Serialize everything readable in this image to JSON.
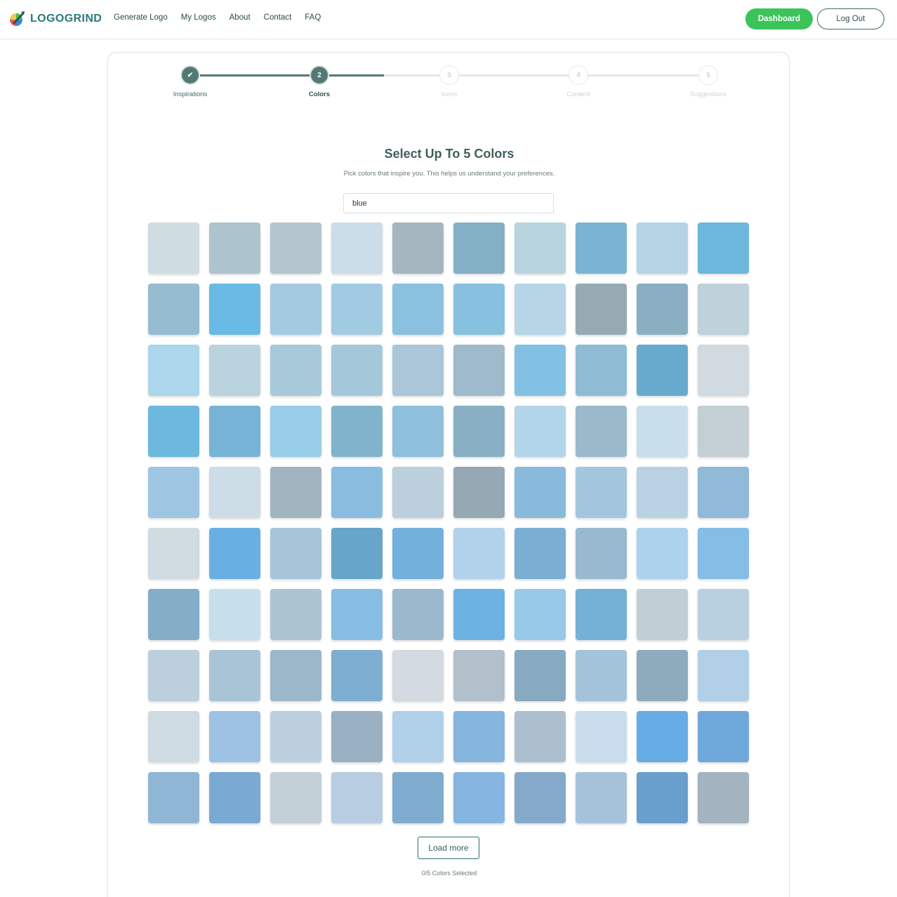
{
  "header": {
    "brand": "LOGOGRIND",
    "nav": [
      "Generate Logo",
      "My Logos",
      "About",
      "Contact",
      "FAQ"
    ],
    "dashboard_label": "Dashboard",
    "logout_label": "Log Out"
  },
  "stepper": {
    "steps": [
      {
        "marker": "✔",
        "label": "Inspirations",
        "state": "done"
      },
      {
        "marker": "2",
        "label": "Colors",
        "state": "active"
      },
      {
        "marker": "3",
        "label": "Icons",
        "state": "todo"
      },
      {
        "marker": "4",
        "label": "Content",
        "state": "todo"
      },
      {
        "marker": "5",
        "label": "Suggestions",
        "state": "todo"
      }
    ]
  },
  "main": {
    "title": "Select Up To 5 Colors",
    "subtitle": "Pick colors that inspire you. This helps us understand your preferences.",
    "search_value": "blue",
    "load_more_label": "Load more",
    "selected_count": "0/5 Colors Selected"
  },
  "colors": {
    "swatches": [
      "#cfdde3",
      "#adc4cf",
      "#b4c4cc",
      "#cadde8",
      "#a5b6c1",
      "#84b0c6",
      "#b8d4df",
      "#7ab4d3",
      "#b4d3e5",
      "#6cb7dc",
      "#95bcd1",
      "#69bae4",
      "#a3cae0",
      "#a1cbe2",
      "#89c1de",
      "#86c1e0",
      "#b6d6e8",
      "#96aab4",
      "#8bafc2",
      "#bfd1da",
      "#abd6eb",
      "#bbd3de",
      "#a8c9da",
      "#a4c8da",
      "#aac6d8",
      "#9fbacb",
      "#82c1e3",
      "#8fbcd4",
      "#67aacd",
      "#d0dae0",
      "#6cb8df",
      "#76b3d6",
      "#98cde9",
      "#81b3cc",
      "#8ebfdb",
      "#88afc3",
      "#b3d5e9",
      "#9ab9cb",
      "#c9deeb",
      "#c3ced5",
      "#9ec6e2",
      "#ccdde8",
      "#a3b4c1",
      "#8abce0",
      "#bbcfdc",
      "#95a8b4",
      "#8abadb",
      "#a3c6df",
      "#b8d2e4",
      "#91b9d8",
      "#d0dbe2",
      "#68b0e2",
      "#a7c4d8",
      "#67a5cb",
      "#72b1dc",
      "#b1d2ea",
      "#7aaed3",
      "#98b9cf",
      "#add2ee",
      "#85bde6",
      "#84adc8",
      "#c6dfeb",
      "#acc4d2",
      "#88bde3",
      "#9bb9cd",
      "#6cb3e3",
      "#98c9e9",
      "#75b1d7",
      "#c0ced5",
      "#b9d0e0",
      "#bbcfdc",
      "#a9c4d6",
      "#9cb7ca",
      "#7eaed0",
      "#d3dae1",
      "#b1c0ca",
      "#87a9c2",
      "#a3c3da",
      "#8eaabd",
      "#b1d0e8",
      "#cfdbe3",
      "#9dc2e3",
      "#bbcfdf",
      "#9ab1c4",
      "#b0d0ea",
      "#86b5de",
      "#acbfcf",
      "#c8dced",
      "#68ace6",
      "#6fa9dc",
      "#90b6d6",
      "#7aaad3",
      "#c3cfd7",
      "#b8cde2",
      "#7fabcf",
      "#85b5e0",
      "#84a9cb",
      "#a6c2da",
      "#699fcc",
      "#a3b3bf"
    ]
  }
}
